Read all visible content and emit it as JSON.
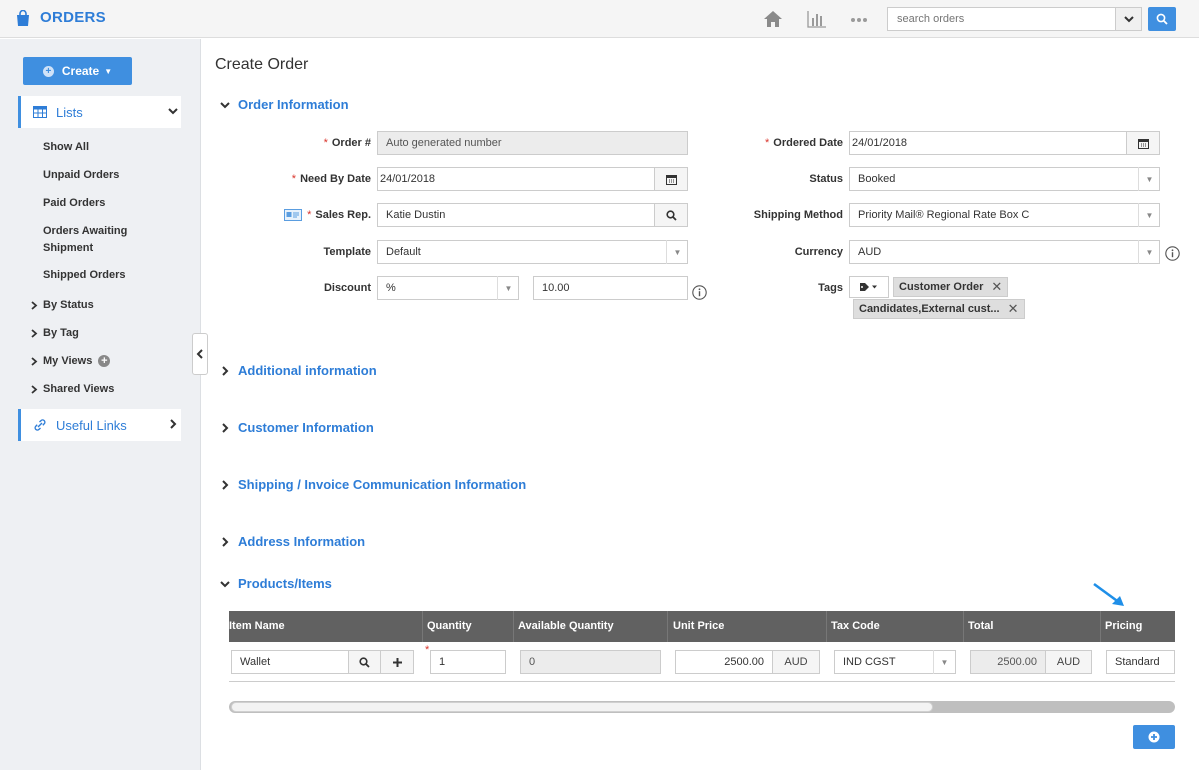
{
  "header": {
    "app_name": "ORDERS",
    "search_placeholder": "search orders",
    "icons": [
      "shopping-bag-icon",
      "home-icon",
      "bar-chart-icon",
      "more-dots-icon",
      "chevron-down-icon",
      "search-icon"
    ]
  },
  "sidebar": {
    "create_label": "Create",
    "lists_label": "Lists",
    "links": [
      "Show All",
      "Unpaid Orders",
      "Paid Orders",
      "Orders Awaiting Shipment",
      "Shipped Orders"
    ],
    "groups": [
      "By Status",
      "By Tag",
      "My Views",
      "Shared Views"
    ],
    "useful_links_label": "Useful Links"
  },
  "main": {
    "title": "Create Order",
    "sections": {
      "order_info": "Order Information",
      "additional": "Additional information",
      "customer": "Customer Information",
      "shipping": "Shipping / Invoice Communication Information",
      "address": "Address Information",
      "products": "Products/Items"
    },
    "form": {
      "order_no_label": "Order #",
      "order_no_value": "Auto generated number",
      "need_by_label": "Need By Date",
      "need_by_value": "24/01/2018",
      "sales_rep_label": "Sales Rep.",
      "sales_rep_value": "Katie Dustin",
      "template_label": "Template",
      "template_value": "Default",
      "discount_label": "Discount",
      "discount_type": "%",
      "discount_value": "10.00",
      "ordered_date_label": "Ordered Date",
      "ordered_date_value": "24/01/2018",
      "status_label": "Status",
      "status_value": "Booked",
      "shipping_method_label": "Shipping Method",
      "shipping_method_value": "Priority Mail® Regional Rate Box C",
      "currency_label": "Currency",
      "currency_value": "AUD",
      "tags_label": "Tags",
      "tags": [
        "Customer Order",
        "Candidates,External cust..."
      ]
    },
    "table": {
      "columns": [
        "Item Name",
        "Quantity",
        "Available Quantity",
        "Unit Price",
        "Tax Code",
        "Total",
        "Pricing"
      ],
      "row": {
        "item_name": "Wallet",
        "quantity": "1",
        "available_quantity": "0",
        "unit_price": "2500.00",
        "unit_currency": "AUD",
        "tax_code": "IND CGST",
        "total": "2500.00",
        "total_currency": "AUD",
        "pricing": "Standard"
      }
    },
    "accent_color": "#2e7dd7"
  }
}
